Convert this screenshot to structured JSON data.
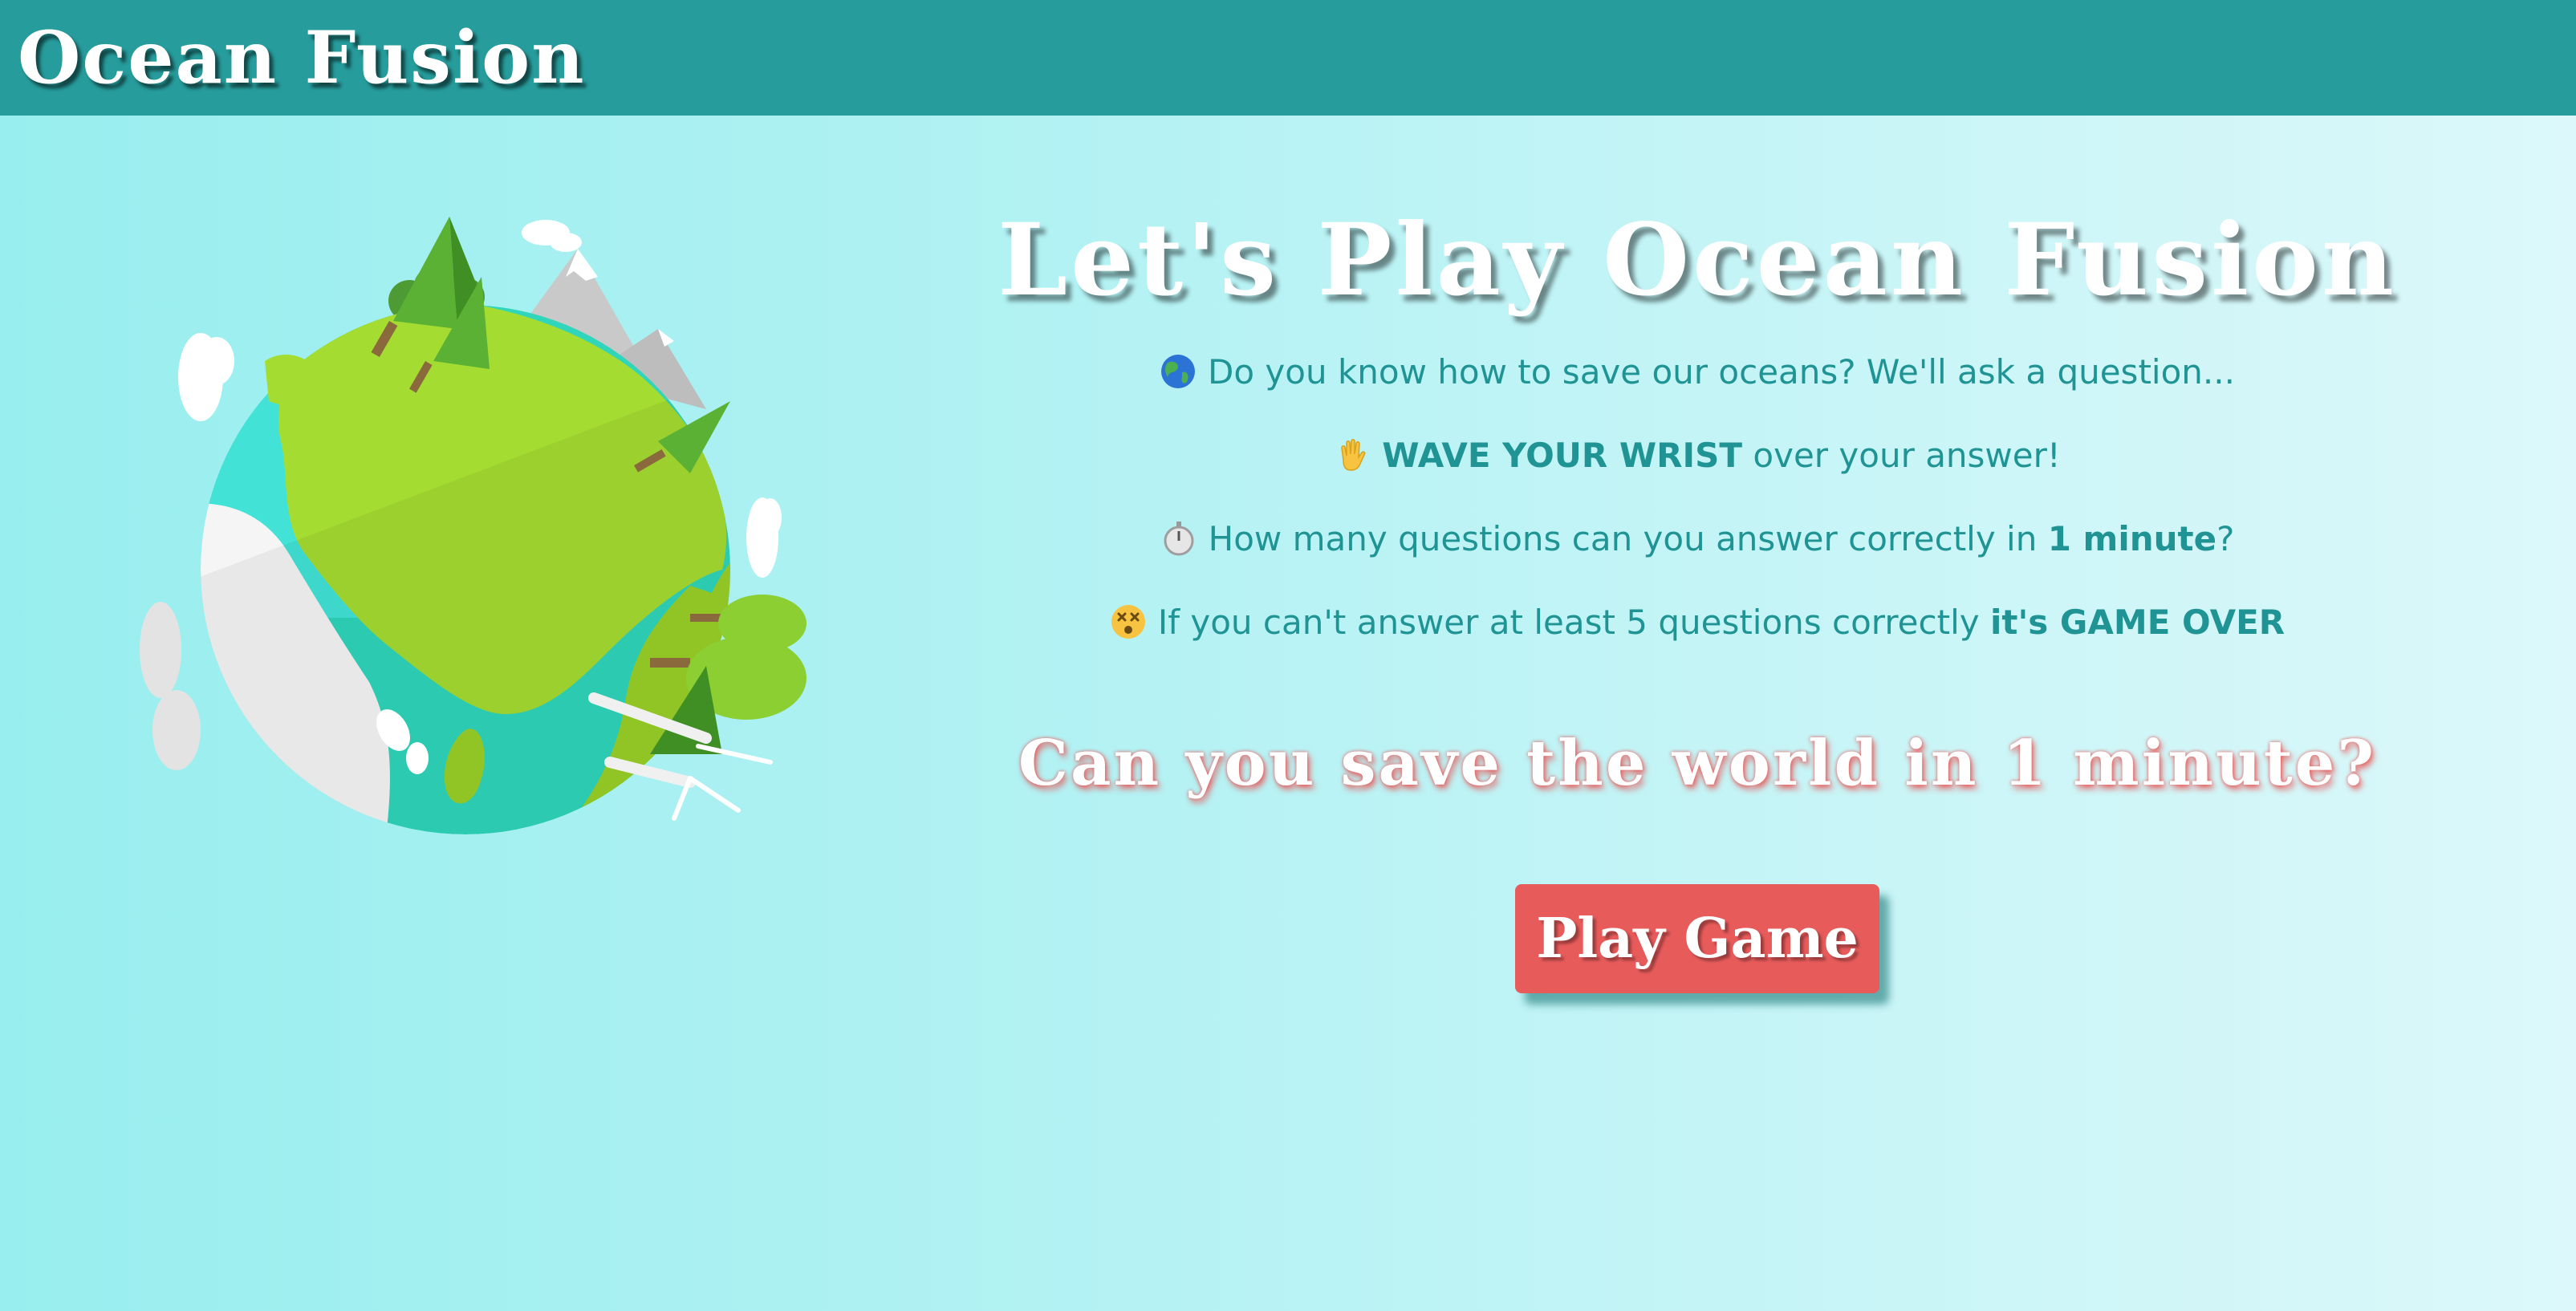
{
  "navbar": {
    "brand": "Ocean Fusion"
  },
  "hero": {
    "title": "Let's Play Ocean Fusion",
    "rules": [
      {
        "icon": "globe-icon",
        "pre": "Do you know how to save our oceans? We'll ask a question...",
        "emph": "",
        "post": ""
      },
      {
        "icon": "waving-hand-icon",
        "pre": "",
        "emph": "WAVE YOUR WRIST",
        "post": " over your answer!"
      },
      {
        "icon": "stopwatch-icon",
        "pre": "How many questions can you answer correctly in ",
        "emph": "1 minute",
        "post": "?"
      },
      {
        "icon": "dizzy-face-icon",
        "pre": "If you can't answer at least 5 questions correctly ",
        "emph": "it's GAME OVER",
        "post": ""
      }
    ],
    "tagline": "Can you save the world in 1 minute?",
    "play_button": "Play Game"
  },
  "colors": {
    "navbar": "#279c9c",
    "text_teal": "#209494",
    "accent_red": "#e85b5b",
    "background_left": "#98eeee",
    "background_right": "#dcf8fa"
  }
}
